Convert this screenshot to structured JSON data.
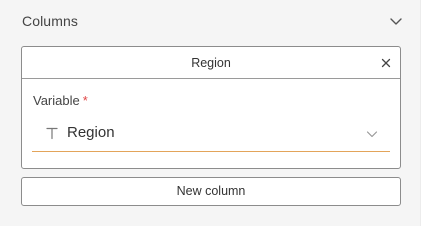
{
  "section": {
    "title": "Columns",
    "toggle_icon": "chevron-down-icon"
  },
  "column_card": {
    "title": "Region",
    "close_icon": "close-icon",
    "variable_field": {
      "label": "Variable",
      "required_marker": "*",
      "type_icon": "text-type-icon",
      "value": "Region",
      "dropdown_icon": "chevron-down-icon"
    }
  },
  "actions": {
    "new_column_label": "New column"
  },
  "colors": {
    "accent_underline": "#e3a45a",
    "required": "#e04545",
    "panel_background": "#f5f5f5",
    "border": "#8c8c8c"
  }
}
